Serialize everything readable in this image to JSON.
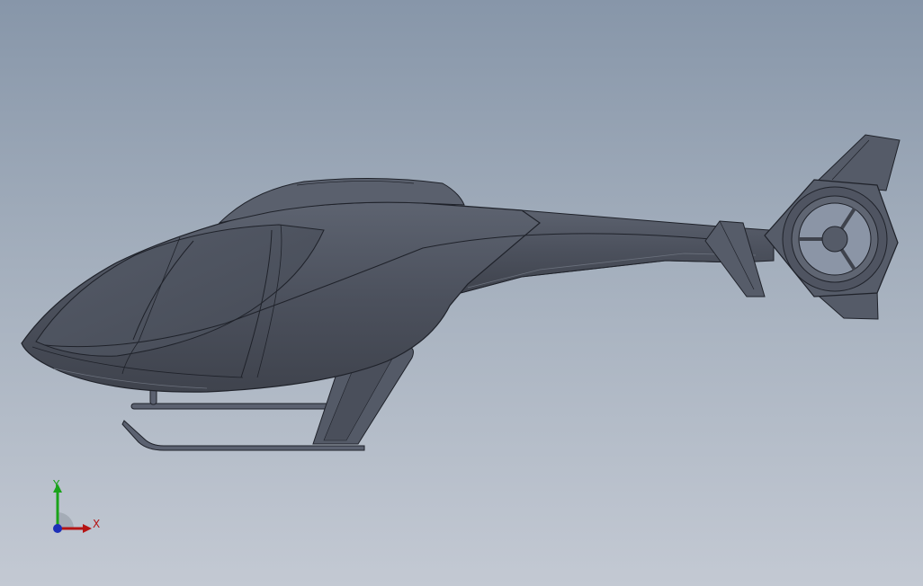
{
  "viewport": {
    "background_top": "#8796a9",
    "background_bottom": "#c3c9d3"
  },
  "model": {
    "body_color": "#4f5460",
    "edge_color": "#1f222a",
    "highlight_color": "#6b717d"
  },
  "triad": {
    "y_label": "Y",
    "x_label": "X",
    "y_color": "#1aa31a",
    "x_color": "#b51414",
    "z_color": "#1c2fb8"
  }
}
